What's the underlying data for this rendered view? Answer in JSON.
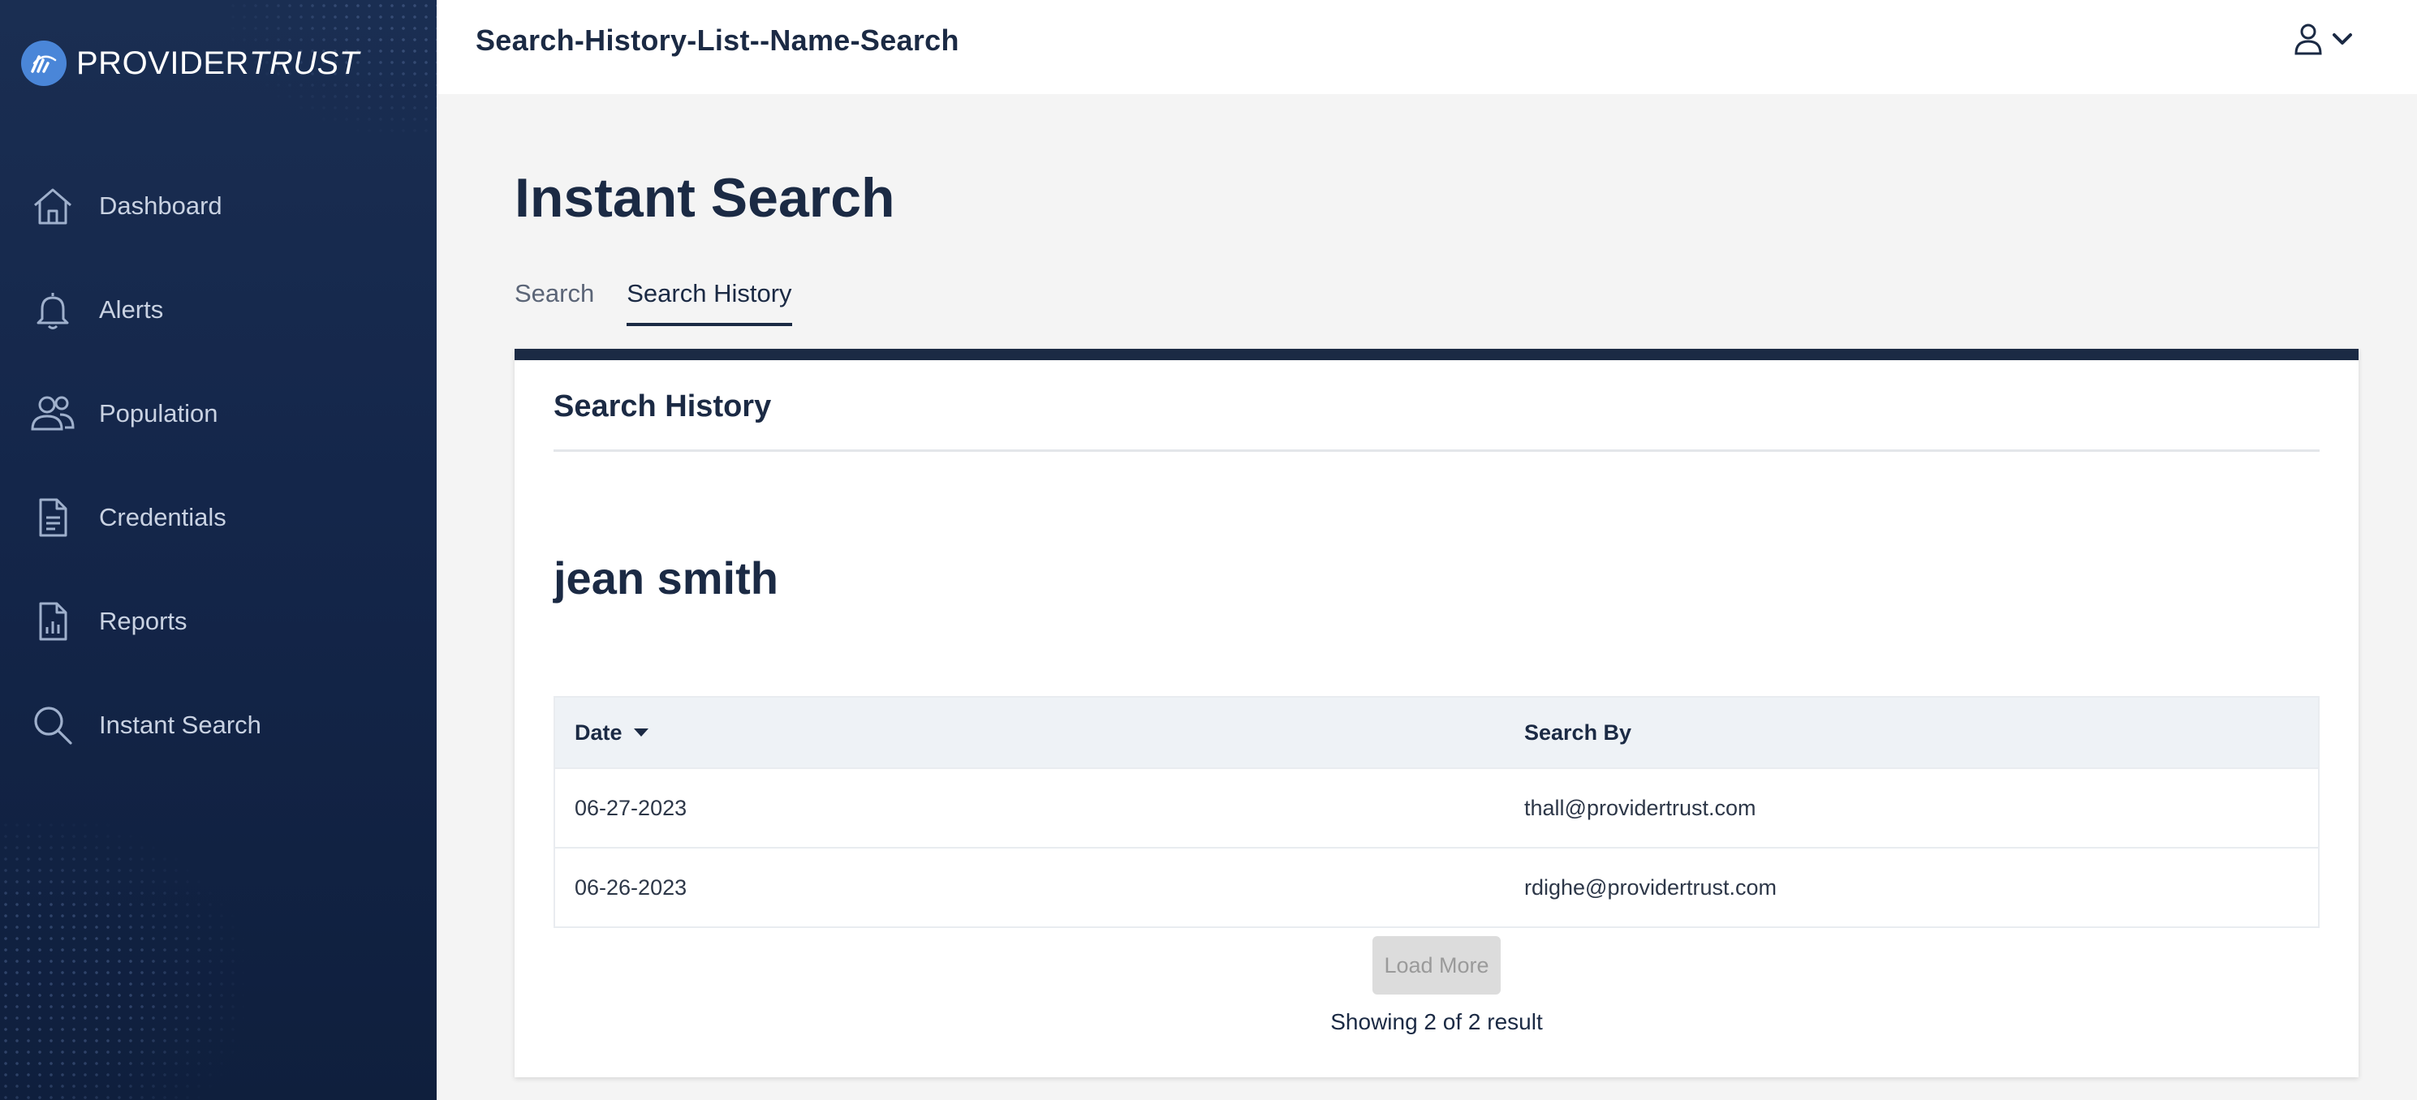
{
  "brand": {
    "name_bold": "PROVIDER",
    "name_italic": "TRUST",
    "accent": "#4a86d8"
  },
  "sidebar": {
    "items": [
      {
        "label": "Dashboard",
        "icon": "home-icon"
      },
      {
        "label": "Alerts",
        "icon": "bell-icon"
      },
      {
        "label": "Population",
        "icon": "users-icon"
      },
      {
        "label": "Credentials",
        "icon": "document-icon"
      },
      {
        "label": "Reports",
        "icon": "report-icon"
      },
      {
        "label": "Instant Search",
        "icon": "search-icon"
      }
    ]
  },
  "header": {
    "title": "Search-History-List--Name-Search",
    "user_icon": "user-icon",
    "chevron_icon": "chevron-down-icon"
  },
  "main": {
    "title": "Instant Search",
    "tabs": [
      {
        "label": "Search",
        "active": false
      },
      {
        "label": "Search History",
        "active": true
      }
    ],
    "card": {
      "title": "Search History",
      "subject": "jean smith",
      "table": {
        "columns": [
          "Date",
          "Search By"
        ],
        "sort_icon": "caret-down-icon",
        "rows": [
          {
            "date": "06-27-2023",
            "search_by": "thall@providertrust.com"
          },
          {
            "date": "06-26-2023",
            "search_by": "rdighe@providertrust.com"
          }
        ]
      },
      "load_more_label": "Load More",
      "result_count": "Showing 2 of 2 result"
    }
  },
  "colors": {
    "navy": "#1b2a44",
    "sidebar_top": "#1a2e52",
    "sidebar_bottom": "#0f1f3d",
    "table_header_bg": "#eef2f6"
  }
}
